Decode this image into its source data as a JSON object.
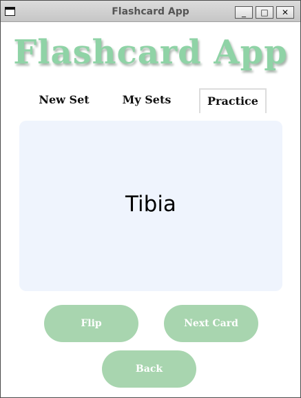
{
  "window": {
    "title": "Flashcard App",
    "controls": {
      "minimize": "_",
      "maximize": "□",
      "close": "✕"
    }
  },
  "header": {
    "app_title": "Flashcard App"
  },
  "tabs": [
    {
      "label": "New Set",
      "selected": false
    },
    {
      "label": "My Sets",
      "selected": false
    },
    {
      "label": "Practice",
      "selected": true
    }
  ],
  "card": {
    "term": "Tibia"
  },
  "buttons": {
    "flip": "Flip",
    "next": "Next Card",
    "back": "Back"
  },
  "colors": {
    "accent_green": "#a8d5af",
    "title_green": "#8fd3a6",
    "card_background": "#eff4fd"
  }
}
